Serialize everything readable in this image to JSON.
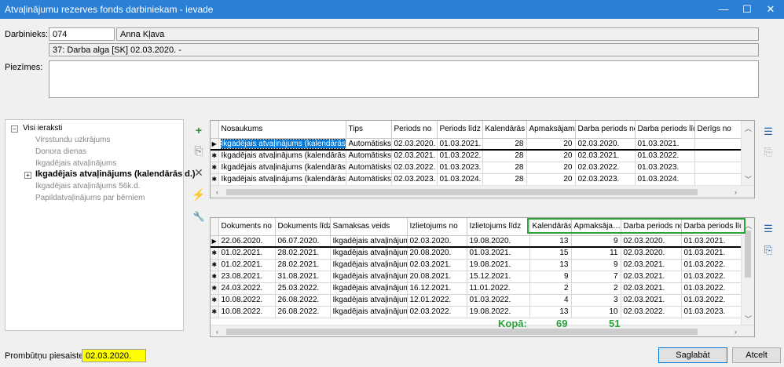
{
  "window": {
    "title": "Atvaļinājumu rezerves fonds darbiniekam - ievade",
    "minimize": "—",
    "maximize": "☐",
    "close": "✕"
  },
  "employee": {
    "label": "Darbinieks:",
    "code": "074",
    "name": "Anna Kļava",
    "position": "37: Darba alga [SK] 02.03.2020. -"
  },
  "notes": {
    "label": "Piezīmes:",
    "value": ""
  },
  "tree": {
    "root": "Visi ieraksti",
    "items": [
      {
        "label": "Virsstundu uzkrājums",
        "bold": false
      },
      {
        "label": "Donora dienas",
        "bold": false
      },
      {
        "label": "Ikgadējais atvaļinājums",
        "bold": false
      },
      {
        "label": "Ikgadējais atvaļinājums (kalendārās d.)",
        "bold": true
      },
      {
        "label": "Ikgadējais atvaļinājums 56k.d.",
        "bold": false
      },
      {
        "label": "Papildatvaļinājums par bērniem",
        "bold": false
      }
    ]
  },
  "tools": {
    "add": "+",
    "copy": "⎘",
    "delete": "✕",
    "run": "⚡",
    "settings": "🔧"
  },
  "top_grid": {
    "columns": [
      "Nosaukums",
      "Tips",
      "Periods no",
      "Periods līdz",
      "Kalendārās",
      "Apmaksājamās",
      "Darba periods no",
      "Darba periods līdz",
      "Derīgs no"
    ],
    "rows": [
      [
        "Ikgadējais atvaļinājums (kalendārās d.)",
        "Automātisks",
        "02.03.2020.",
        "01.03.2021.",
        "28",
        "20",
        "02.03.2020.",
        "01.03.2021.",
        ""
      ],
      [
        "Ikgadējais atvaļinājums (kalendārās d.)",
        "Automātisks",
        "02.03.2021.",
        "01.03.2022.",
        "28",
        "20",
        "02.03.2021.",
        "01.03.2022.",
        ""
      ],
      [
        "Ikgadējais atvaļinājums (kalendārās d.)",
        "Automātisks",
        "02.03.2022.",
        "01.03.2023.",
        "28",
        "20",
        "02.03.2022.",
        "01.03.2023.",
        ""
      ],
      [
        "Ikgadējais atvaļinājums (kalendārās d.)",
        "Automātisks",
        "02.03.2023.",
        "01.03.2024.",
        "28",
        "20",
        "02.03.2023.",
        "01.03.2024.",
        ""
      ]
    ]
  },
  "bottom_grid": {
    "columns": [
      "Dokuments no",
      "Dokuments līdz",
      "Samaksas veids",
      "Izlietojums no",
      "Izlietojums līdz",
      "Kalendārās",
      "Apmaksāja…",
      "Darba periods no",
      "Darba periods līdz"
    ],
    "rows": [
      [
        "22.06.2020.",
        "06.07.2020.",
        "Ikgadējais atvaļinājums",
        "02.03.2020.",
        "19.08.2020.",
        "13",
        "9",
        "02.03.2020.",
        "01.03.2021."
      ],
      [
        "01.02.2021.",
        "28.02.2021.",
        "Ikgadējais atvaļinājums",
        "20.08.2020.",
        "01.03.2021.",
        "15",
        "11",
        "02.03.2020.",
        "01.03.2021."
      ],
      [
        "01.02.2021.",
        "28.02.2021.",
        "Ikgadējais atvaļinājums",
        "02.03.2021.",
        "19.08.2021.",
        "13",
        "9",
        "02.03.2021.",
        "01.03.2022."
      ],
      [
        "23.08.2021.",
        "31.08.2021.",
        "Ikgadējais atvaļinājums",
        "20.08.2021.",
        "15.12.2021.",
        "9",
        "7",
        "02.03.2021.",
        "01.03.2022."
      ],
      [
        "24.03.2022.",
        "25.03.2022.",
        "Ikgadējais atvaļinājums",
        "16.12.2021.",
        "11.01.2022.",
        "2",
        "2",
        "02.03.2021.",
        "01.03.2022."
      ],
      [
        "10.08.2022.",
        "26.08.2022.",
        "Ikgadējais atvaļinājums",
        "12.01.2022.",
        "01.03.2022.",
        "4",
        "3",
        "02.03.2021.",
        "01.03.2022."
      ],
      [
        "10.08.2022.",
        "26.08.2022.",
        "Ikgadējais atvaļinājums",
        "02.03.2022.",
        "19.08.2022.",
        "13",
        "10",
        "02.03.2022.",
        "01.03.2023."
      ]
    ],
    "total_label": "Kopā:",
    "total_calendar": "69",
    "total_paid": "51"
  },
  "footer": {
    "link_label": "Prombūtņu piesaiste no:",
    "link_date": "02.03.2020.",
    "save": "Saglabāt",
    "cancel": "Atcelt"
  },
  "colors": {
    "titlebar": "#2b7fd4",
    "highlight": "#2aa43a",
    "date_field": "#ffff00"
  }
}
